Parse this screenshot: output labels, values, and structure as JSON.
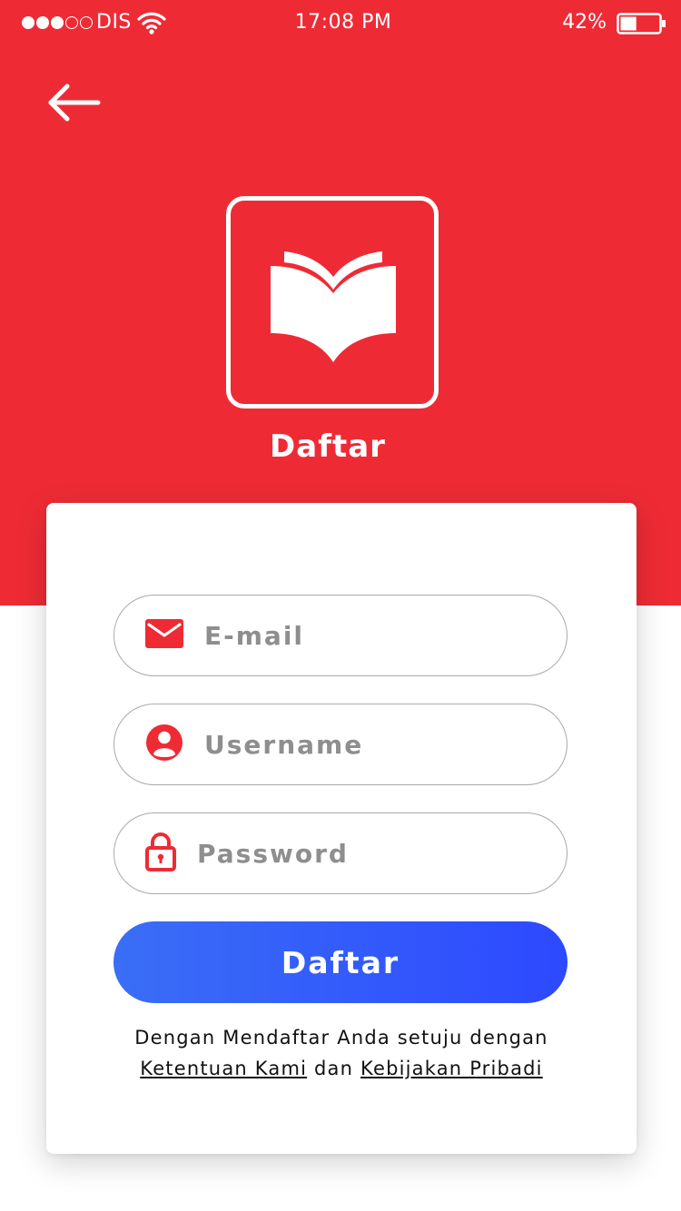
{
  "status_bar": {
    "carrier": "DIS",
    "signal_bars_filled": 3,
    "signal_bars_total": 5,
    "time": "17:08 PM",
    "battery_percent": "42%",
    "battery_level": 0.42
  },
  "header": {
    "back_icon": "arrow-left-icon",
    "logo_icon": "open-book-icon",
    "title": "Daftar"
  },
  "form": {
    "email": {
      "icon": "envelope-icon",
      "placeholder": "E-mail",
      "value": ""
    },
    "username": {
      "icon": "user-circle-icon",
      "placeholder": "Username",
      "value": ""
    },
    "password": {
      "icon": "lock-icon",
      "placeholder": "Password",
      "value": ""
    },
    "submit_label": "Daftar"
  },
  "terms": {
    "line1": "Dengan Mendaftar Anda setuju dengan",
    "link_terms": "Ketentuan Kami",
    "conjunction": "dan",
    "link_privacy": "Kebijakan Pribadi"
  },
  "colors": {
    "primary_red": "#ee2b35",
    "button_gradient_start": "#3a6ef6",
    "button_gradient_end": "#2d49ff",
    "placeholder_gray": "#8e8e8e",
    "field_border": "#aaaaaa"
  }
}
